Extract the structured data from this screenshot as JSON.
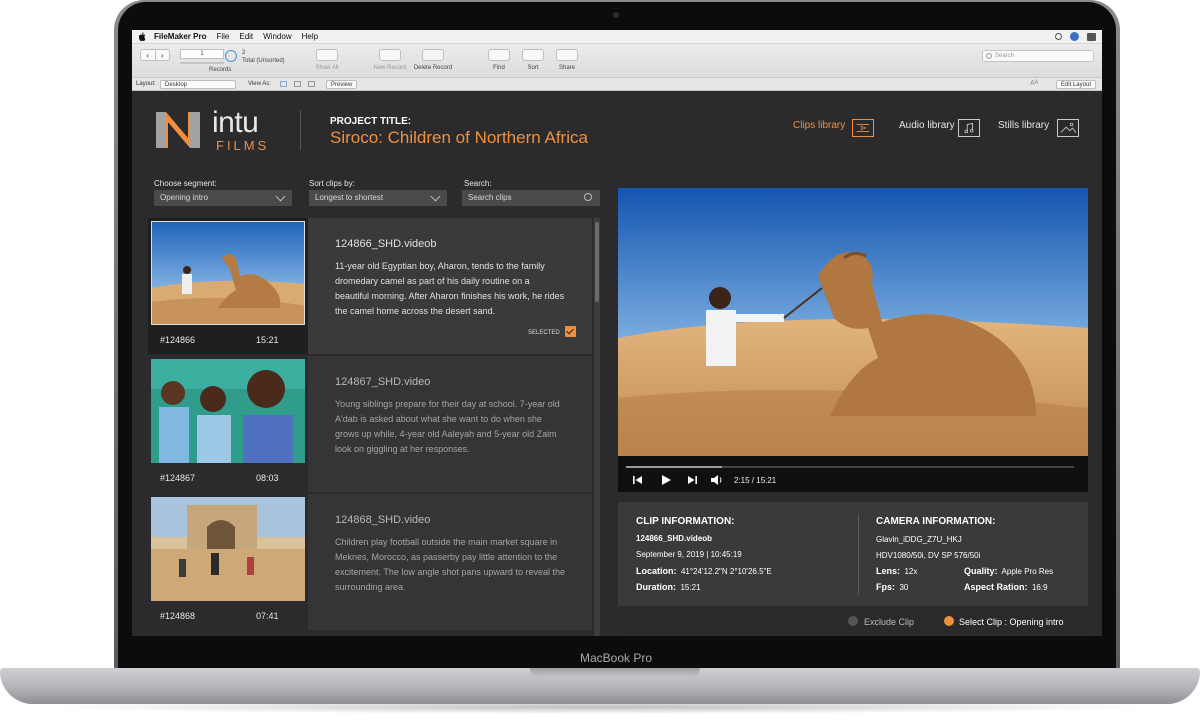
{
  "device": {
    "label": "MacBook Pro"
  },
  "menubar": {
    "app": "FileMaker Pro",
    "items": [
      "File",
      "Edit",
      "Window",
      "Help"
    ]
  },
  "toolbar": {
    "record_field": "1",
    "found_count": "2",
    "found_status": "Total (Unsorted)",
    "records_label": "Records",
    "show_all": "Show All",
    "new_record": "New Record",
    "delete_record": "Delete Record",
    "find": "Find",
    "sort": "Sort",
    "share": "Share",
    "search_placeholder": "Search"
  },
  "layoutbar": {
    "layout_label": "Layout:",
    "layout_value": "Desktop",
    "view_as_label": "View As:",
    "preview": "Preview",
    "font_size_glyph": "Aᴬ",
    "edit_layout": "Edit Layout"
  },
  "header": {
    "logo_word": "intu",
    "logo_sub": "FILMS",
    "project_label": "PROJECT TITLE:",
    "project_title": "Siroco: Children of Northern Africa",
    "nav": [
      {
        "label": "Clips library",
        "active": true
      },
      {
        "label": "Audio library",
        "active": false
      },
      {
        "label": "Stills library",
        "active": false
      }
    ],
    "accent": "#f0903e"
  },
  "filters": {
    "segment_label": "Choose segment:",
    "segment_value": "Opening intro",
    "sort_label": "Sort clips by:",
    "sort_value": "Longest to shortest",
    "search_label": "Search:",
    "search_placeholder": "Search clips"
  },
  "clips": [
    {
      "id": "#124866",
      "duration": "15:21",
      "name": "124866_SHD.videob",
      "description": "11-year old Egyptian boy, Aharon, tends to the family dromedary camel as part of his daily routine on a beautiful morning.  After Aharon finishes his work, he rides the camel home across the desert sand.",
      "selected_label": "SELECTED"
    },
    {
      "id": "#124867",
      "duration": "08:03",
      "name": "124867_SHD.video",
      "description": "Young siblings prepare for their day at school.  7-year old A'dab is asked about what she want to do when she grows up while, 4-year old Aaleyah and 5-year old Zaim look on giggling at her responses."
    },
    {
      "id": "#124868",
      "duration": "07:41",
      "name": "124868_SHD.video",
      "description": "Children play football outside the main market square in Meknes, Morocco, as passerby pay little attention to the excitement.  The low angle shot pans upward to reveal the surrounding area."
    }
  ],
  "player": {
    "timecode": "2:15 / 15:21",
    "progress": 0.215
  },
  "clip_info": {
    "heading": "CLIP INFORMATION:",
    "file": "124866_SHD.videob",
    "date": "September 9, 2019  |  10:45:19",
    "location_label": "Location:",
    "location_value": "41°24'12.2\"N   2°10'26.5\"E",
    "duration_label": "Duration:",
    "duration_value": "15:21"
  },
  "camera_info": {
    "heading": "CAMERA INFORMATION:",
    "line1": "Glavin_iDDG_Z7U_HKJ",
    "line2": "HDV1080/50i, DV SP 576/50i",
    "lens_label": "Lens:",
    "lens_value": "12x",
    "fps_label": "Fps:",
    "fps_value": "30",
    "quality_label": "Quality:",
    "quality_value": "Apple Pro Res",
    "aspect_label": "Aspect Ration:",
    "aspect_value": "16:9"
  },
  "footer": {
    "exclude": "Exclude Clip",
    "select": "Select Clip : Opening intro"
  }
}
